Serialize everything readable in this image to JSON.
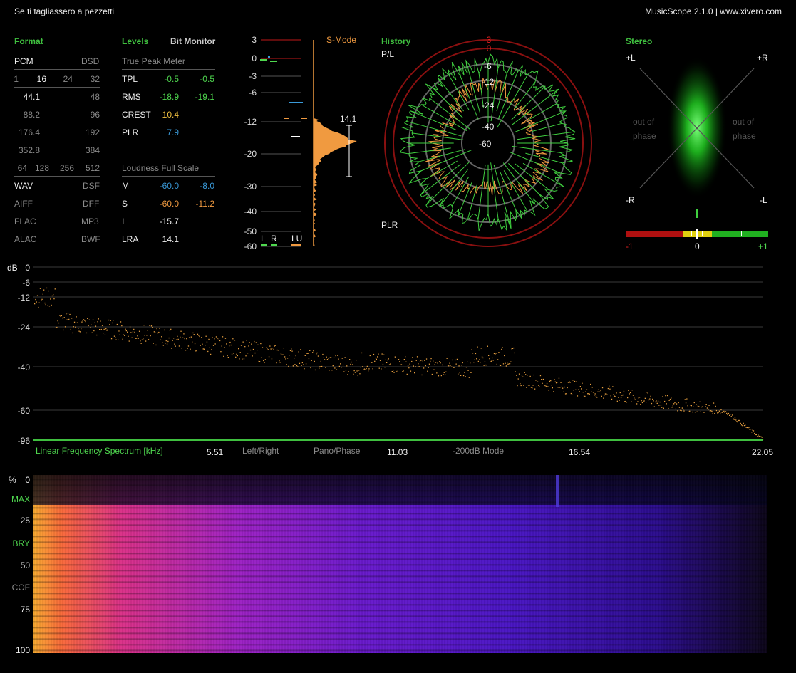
{
  "window": {
    "song_title": "Se ti tagliassero a pezzetti",
    "app_title": "MusicScope 2.1.0 | www.xivero.com"
  },
  "format": {
    "header": "Format",
    "pcm": "PCM",
    "dsd": "DSD",
    "bitdepth": [
      "1",
      "16",
      "24",
      "32"
    ],
    "rates_left": [
      "44.1",
      "88.2",
      "176.4",
      "352.8"
    ],
    "rates_right": [
      "48",
      "96",
      "192",
      "384"
    ],
    "dsd_rates": [
      "64",
      "128",
      "256",
      "512"
    ],
    "files_left": [
      "WAV",
      "AIFF",
      "FLAC",
      "ALAC"
    ],
    "files_right": [
      "DSF",
      "DFF",
      "MP3",
      "BWF"
    ]
  },
  "levels": {
    "header": "Levels",
    "bit_monitor": "Bit Monitor",
    "true_peak_title": "True Peak Meter",
    "rows": [
      {
        "label": "TPL",
        "l": "-0.5",
        "r": "-0.5"
      },
      {
        "label": "RMS",
        "l": "-18.9",
        "r": "-19.1"
      },
      {
        "label": "CREST",
        "l": "10.4",
        "r": ""
      },
      {
        "label": "PLR",
        "l": "7.9",
        "r": ""
      }
    ],
    "loudness_title": "Loudness Full Scale",
    "loud_rows": [
      {
        "label": "M",
        "a": "-60.0",
        "b": "-8.0"
      },
      {
        "label": "S",
        "a": "-60.0",
        "b": "-11.2"
      },
      {
        "label": "I",
        "a": "-15.7",
        "b": ""
      },
      {
        "label": "LRA",
        "a": "14.1",
        "b": ""
      }
    ]
  },
  "meter": {
    "scale": [
      "3",
      "0",
      "-3",
      "-6",
      "-12",
      "-20",
      "-30",
      "-40",
      "-50",
      "-60"
    ],
    "smode": "S-Mode",
    "channels": [
      "L",
      "R",
      "LU"
    ],
    "lra_value": "14.1"
  },
  "history": {
    "header": "History",
    "pl": "P/L",
    "plr": "PLR",
    "rings": [
      "3",
      "0",
      "-6",
      "-12",
      "-24",
      "-40",
      "-60"
    ]
  },
  "stereo": {
    "header": "Stereo",
    "corners": [
      "+L",
      "+R",
      "-R",
      "-L"
    ],
    "out_of_phase": [
      "out of",
      "phase"
    ],
    "scale": [
      "-1",
      "0",
      "+1"
    ],
    "correlation": 0.62
  },
  "spectrum": {
    "db_unit": "dB",
    "db_ticks": [
      "0",
      "-6",
      "-12",
      "-24",
      "-40",
      "-60",
      "-96"
    ],
    "title": "Linear Frequency Spectrum [kHz]",
    "modes": [
      "Left/Right",
      "Pano/Phase",
      "-200dB Mode"
    ],
    "freq_ticks": [
      "5.51",
      "11.03",
      "16.54",
      "22.05"
    ]
  },
  "spectrogram": {
    "unit": "%",
    "labels": [
      "0",
      "MAX",
      "25",
      "BRY",
      "50",
      "COF",
      "75",
      "100"
    ]
  },
  "colors": {
    "accent_green": "#3fbf3f",
    "orange": "#f09a40",
    "blue": "#3a9ad9",
    "red": "#e02020"
  }
}
